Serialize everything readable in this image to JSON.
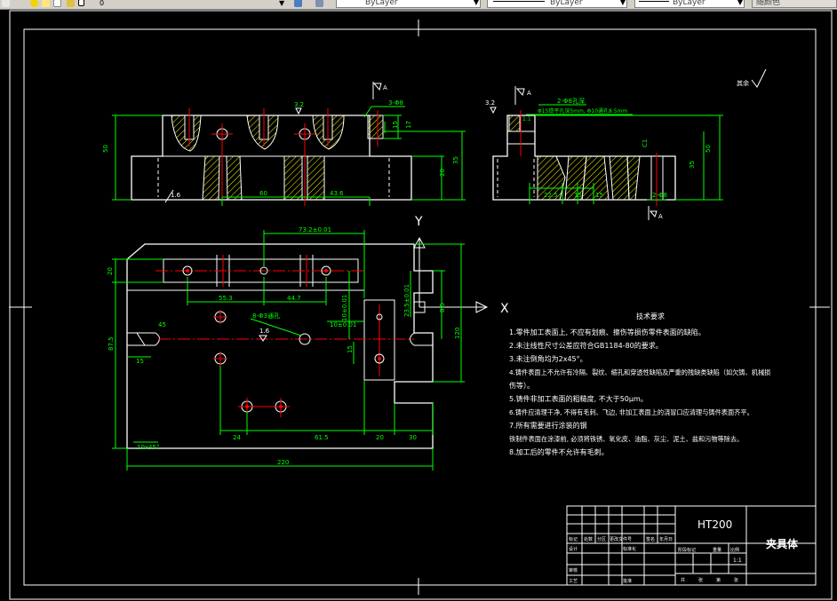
{
  "toolbar": {
    "layer_value": "0",
    "color_value": "ByLayer",
    "linetype_value": "ByLayer",
    "lineweight_value": "ByLayer",
    "plotstyle_value": "随颜色",
    "icons": [
      "lightbulb-icon",
      "sun-icon",
      "color-square-icon",
      "lock-icon",
      "layer-stack-icon",
      "layers-icon"
    ]
  },
  "colors": {
    "background": "#000000",
    "outline": "#ffffff",
    "dimension": "#00ff00",
    "centerline": "#ff0000",
    "hatch": "#ffff00",
    "hidden": "#ffffff"
  },
  "drawing": {
    "top_view": {
      "dims": [
        "50",
        "20",
        "35",
        "60",
        "43.6",
        "17",
        "15",
        "3-Φ8",
        "3.2",
        "A"
      ],
      "roughness": "1.6"
    },
    "side_view": {
      "dims": [
        "50",
        "35",
        "22.5",
        "15",
        "15",
        "2-Φ8",
        "1:1",
        "2-Φ8孔深",
        "Φ15锪平孔深5mm, Φ10通孔8.5mm",
        "3.2",
        "C1",
        "A"
      ]
    },
    "plan_view": {
      "dims": [
        "73.2±0.01",
        "20",
        "55.3",
        "44.7",
        "10±0.01",
        "23.5±0.01",
        "8.5",
        "120",
        "87.5",
        "15",
        "10±0.01",
        "15",
        "8-Φ3通孔",
        "1.6",
        "45",
        "24",
        "61.5",
        "20",
        "30",
        "10x45°",
        "220"
      ],
      "axis_y": "Y",
      "axis_x": "X"
    },
    "roughness_mark": "其余"
  },
  "tech_requirements": {
    "title": "技术要求",
    "items": [
      "1.零件加工表面上, 不应有划痕、擦伤等损伤零件表面的缺陷。",
      "2.未注线性尺寸公差应符合GB1184-80的要求。",
      "3.未注倒角均为2x45°。",
      "4.铸件表面上不允许有冷隔、裂纹、缩孔和穿透性缺陷及严重的残缺类缺陷（如欠铸、机械损",
      "伤等）。",
      "5.铸件非加工表面的粗糙度, 不大于50μm。",
      "6.铸件应清理干净, 不得有毛刺、飞边, 非加工表面上的浇冒口应清理与铸件表面齐平。",
      "7.所有需要进行涂装的钢",
      "铁制件表面在涂漆前, 必须将铁锈、氧化皮、油脂、灰尘、泥土、盐和污物等除去。",
      "8.加工后的零件不允许有毛刺。"
    ]
  },
  "title_block": {
    "material": "HT200",
    "part_name": "夹具体",
    "scale": "1:1",
    "labels": [
      "标记",
      "处数",
      "分区",
      "更改文件号",
      "签名",
      "年月日",
      "设计",
      "标准化",
      "阶段标记",
      "重量",
      "比例",
      "审核",
      "工艺",
      "批准",
      "共",
      "张",
      "第",
      "张"
    ]
  }
}
